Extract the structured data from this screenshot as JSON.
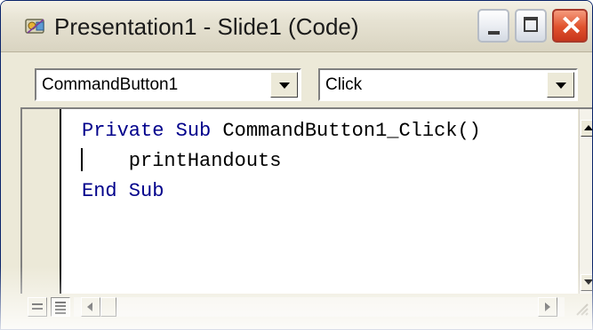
{
  "window": {
    "title": "Presentation1 - Slide1 (Code)",
    "icons": {
      "app": "vba-module-icon",
      "minimize": "minimize-icon",
      "maximize": "maximize-icon",
      "close": "close-icon"
    },
    "colors": {
      "close_button": "#e0512d",
      "keyword": "#00008b",
      "code_text": "#000000"
    }
  },
  "dropdowns": {
    "object": {
      "value": "CommandButton1"
    },
    "procedure": {
      "value": "Click"
    }
  },
  "code": {
    "lines": [
      "Private Sub CommandButton1_Click()",
      "    printHandouts",
      "End Sub"
    ],
    "line1_keywords": "Private Sub",
    "line1_name": " CommandButton1_Click()",
    "line3_keywords": "End Sub"
  },
  "footer": {
    "view_buttons": [
      "procedure-view",
      "full-module-view"
    ]
  }
}
